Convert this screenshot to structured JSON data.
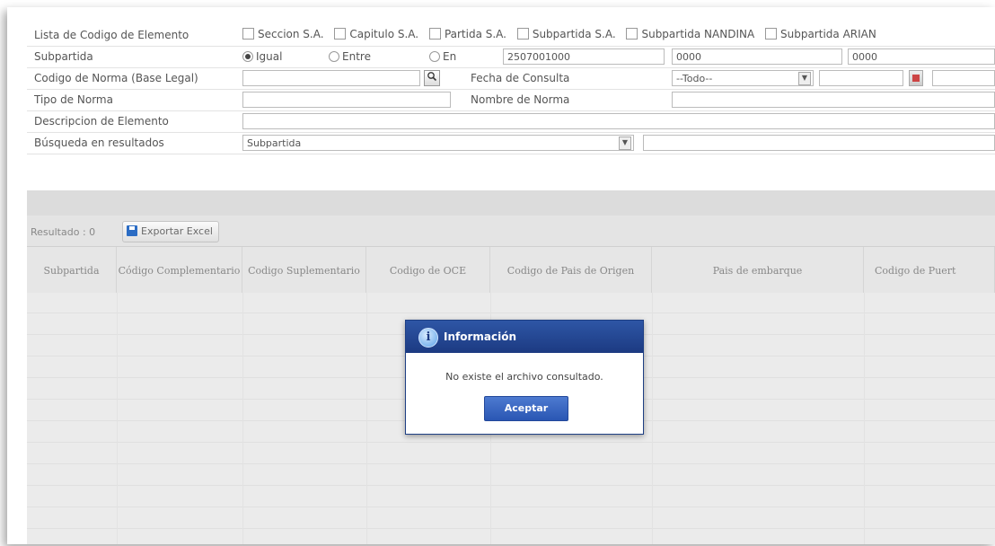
{
  "form": {
    "lista_label": "Lista de Codigo de Elemento",
    "lista_options": [
      "Seccion S.A.",
      "Capitulo S.A.",
      "Partida S.A.",
      "Subpartida S.A.",
      "Subpartida NANDINA",
      "Subpartida ARIAN"
    ],
    "subpartida_label": "Subpartida",
    "radio_igual": "Igual",
    "radio_entre": "Entre",
    "radio_en": "En",
    "subpartida_value": "2507001000",
    "subpartida_from": "0000",
    "subpartida_to": "0000",
    "norma_label": "Codigo de Norma (Base Legal)",
    "norma_value": "",
    "fecha_label": "Fecha de Consulta",
    "fecha_option": "--Todo--",
    "tipo_norma_label": "Tipo de Norma",
    "nombre_norma_label": "Nombre de Norma",
    "descripcion_label": "Descripcion de Elemento",
    "busqueda_label": "Búsqueda en resultados",
    "busqueda_option": "Subpartida"
  },
  "results": {
    "label": "Resultado : 0",
    "export_label": "Exportar Excel",
    "columns": [
      "Subpartida",
      "Código Complementario",
      "Codigo Suplementario",
      "Codigo de OCE",
      "Codigo de Pais de Origen",
      "Pais de embarque",
      "Codigo de Puert"
    ]
  },
  "dialog": {
    "title": "Información",
    "message": "No existe el archivo consultado.",
    "button": "Aceptar"
  },
  "colors": {
    "dialog_header": "#1c3a82",
    "accept_button": "#2a56b3",
    "grid_background": "#ebebeb"
  },
  "icons": [
    "checkbox-icon",
    "radio-icon",
    "search-icon",
    "dropdown-arrow-icon",
    "calendar-icon",
    "save-disk-icon",
    "info-icon"
  ]
}
